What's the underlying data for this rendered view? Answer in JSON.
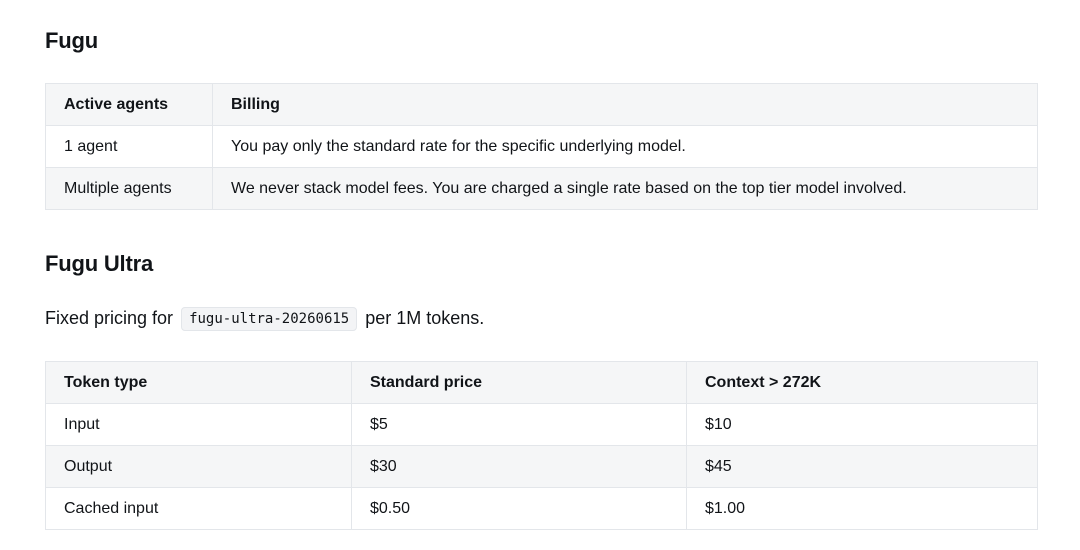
{
  "fugu": {
    "heading": "Fugu",
    "table": {
      "headers": [
        "Active agents",
        "Billing"
      ],
      "rows": [
        [
          "1 agent",
          "You pay only the standard rate for the specific underlying model."
        ],
        [
          "Multiple agents",
          "We never stack model fees. You are charged a single rate based on the top tier model involved."
        ]
      ]
    }
  },
  "fugu_ultra": {
    "heading": "Fugu Ultra",
    "intro": {
      "prefix": "Fixed pricing for",
      "model_code": "fugu-ultra-20260615",
      "suffix": "per 1M tokens."
    },
    "table": {
      "headers": [
        "Token type",
        "Standard price",
        "Context > 272K"
      ],
      "rows": [
        [
          "Input",
          "$5",
          "$10"
        ],
        [
          "Output",
          "$30",
          "$45"
        ],
        [
          "Cached input",
          "$0.50",
          "$1.00"
        ]
      ]
    }
  },
  "colors": {
    "text": "#111418",
    "header_bg": "#f5f6f7",
    "border": "#e3e6ea"
  }
}
